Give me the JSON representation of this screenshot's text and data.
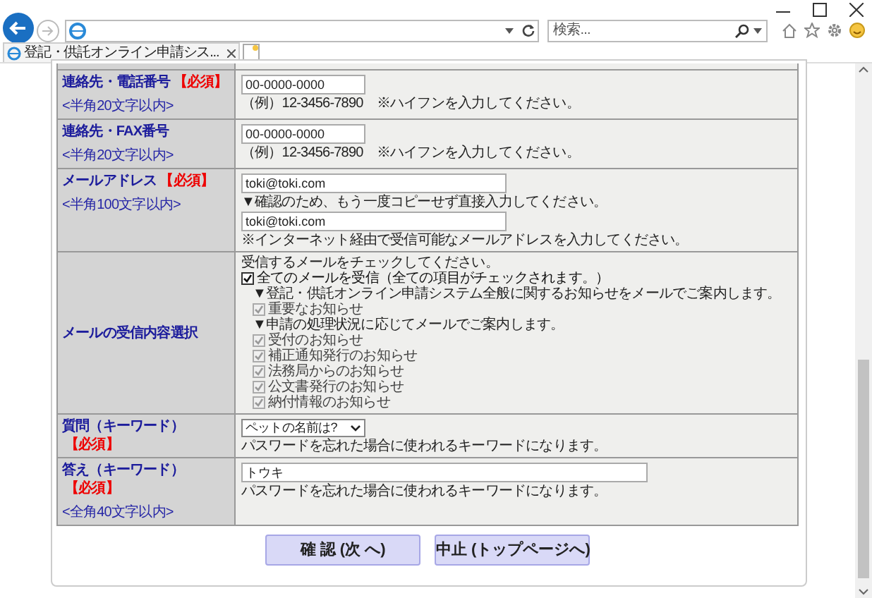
{
  "browser": {
    "tab_title": "登記・供託オンライン申請シス...",
    "search_placeholder": "検索..."
  },
  "form": {
    "rows": [
      {
        "label": "連絡先・電話番号",
        "required_mark": "【必須】",
        "note": "<半角20文字以内>",
        "items": [
          {
            "kind": "short_input",
            "value": "00-0000-0000"
          },
          {
            "kind": "text",
            "text": "（例）12-3456-7890　※ハイフンを入力してください。"
          }
        ]
      },
      {
        "label": "連絡先・FAX番号",
        "note": "<半角20文字以内>",
        "items": [
          {
            "kind": "short_input",
            "value": "00-0000-0000"
          },
          {
            "kind": "text",
            "text": "（例）12-3456-7890　※ハイフンを入力してください。"
          }
        ]
      },
      {
        "label": "メールアドレス",
        "required_mark": "【必須】",
        "note": "<半角100文字以内>",
        "items": [
          {
            "kind": "input",
            "value": "toki@toki.com"
          },
          {
            "kind": "text",
            "text": "▼確認のため、もう一度コピーせず直接入力してください。"
          },
          {
            "kind": "input",
            "value": "toki@toki.com"
          },
          {
            "kind": "text",
            "text": "※インターネット経由で受信可能なメールアドレスを入力してください。"
          }
        ]
      },
      {
        "label": "メールの受信内容選択",
        "items": [
          {
            "kind": "text",
            "text": "受信するメールをチェックしてください。"
          },
          {
            "kind": "checkbox",
            "label": "全てのメールを受信（全ての項目がチェックされます。）",
            "checked": true,
            "disabled": false
          },
          {
            "kind": "sub_text",
            "text": "▼登記・供託オンライン申請システム全般に関するお知らせをメールでご案内します。"
          },
          {
            "kind": "sub_checkbox",
            "label": "重要なお知らせ",
            "checked": true,
            "disabled": true
          },
          {
            "kind": "sub_text",
            "text": "▼申請の処理状況に応じてメールでご案内します。"
          },
          {
            "kind": "sub_checkbox",
            "label": "受付のお知らせ",
            "checked": true,
            "disabled": true
          },
          {
            "kind": "sub_checkbox",
            "label": "補正通知発行のお知らせ",
            "checked": true,
            "disabled": true
          },
          {
            "kind": "sub_checkbox",
            "label": "法務局からのお知らせ",
            "checked": true,
            "disabled": true
          },
          {
            "kind": "sub_checkbox",
            "label": "公文書発行のお知らせ",
            "checked": true,
            "disabled": true
          },
          {
            "kind": "sub_checkbox",
            "label": "納付情報のお知らせ",
            "checked": true,
            "disabled": true
          }
        ]
      },
      {
        "label": "質問（キーワード）",
        "required_mark": "【必須】",
        "items": [
          {
            "kind": "select",
            "value": "ペットの名前は?"
          },
          {
            "kind": "text",
            "text": "パスワードを忘れた場合に使われるキーワードになります。"
          }
        ]
      },
      {
        "label": "答え（キーワード）",
        "required_mark": "【必須】",
        "note": "<全角40文字以内>",
        "items": [
          {
            "kind": "long_input",
            "value": "トウキ"
          },
          {
            "kind": "text",
            "text": "パスワードを忘れた場合に使われるキーワードになります。"
          }
        ]
      }
    ]
  },
  "buttons": [
    "確 認 (次 へ)",
    "中止 (トップページへ)"
  ]
}
